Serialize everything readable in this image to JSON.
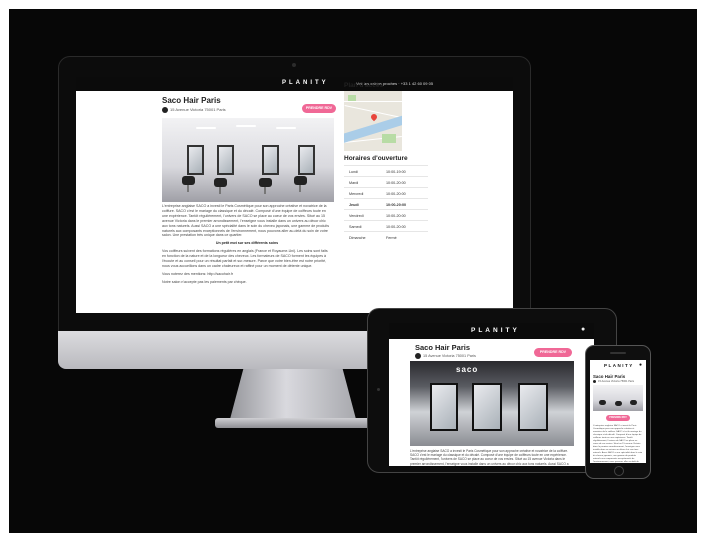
{
  "brand": "PLANITY",
  "top_links": "Voir les salons proches   ·   +33 1 42 60 09 05",
  "salon": {
    "name": "Saco Hair Paris",
    "address": "15 Avenue Victoria 75001 Paris",
    "cta_label": "PRENDRE RDV"
  },
  "map_section": {
    "title": "Plan d'accès"
  },
  "hours_section": {
    "title": "Horaires d'ouverture",
    "rows": [
      {
        "day": "Lundi",
        "hours": "10:00-19:00"
      },
      {
        "day": "Mardi",
        "hours": "10:00-20:00"
      },
      {
        "day": "Mercredi",
        "hours": "10:00-20:00"
      },
      {
        "day": "Jeudi",
        "hours": "10:00-20:00"
      },
      {
        "day": "Vendredi",
        "hours": "10:00-20:00"
      },
      {
        "day": "Samedi",
        "hours": "10:00-20:00"
      },
      {
        "day": "Dimanche",
        "hours": "Fermé"
      }
    ]
  },
  "description": {
    "p1": "L'entreprise anglaise SACO a investi le Paris Cosmétique pour son approche créative et novatrice de la coiffure. SACO c'est le mariage du classique et du décalé. Composé d'une équipe de coiffeurs toute en une expérience. Tantôt régulièrement, l'univers de SACO se place au coeur de vos envies. Situé au 15 avenue Victoria dans le premier arrondissement, l'enseigne vous installe dans un univers au décor chic aux tons naturels. Aussi SACO a une spécialité dans le soin du cheveu japonais, une gamme de produits naturels aux composants exceptionnels de l'environnement, nous pouvons aller au-delà du soin de votre salon. Une prestation très unique dans ce quartier.",
    "heading": "Un petit mot sur ses différents soins",
    "p2": "Vos coiffeurs suivent des formations régulières en anglais (France et Royaume-Uni). Les soins sont faits en fonction de la nature et de la longueur des cheveux. Les formateurs de SACO forment les équipes à l'écoute et au conseil pour un résultat parfait et sur-mesure. Parce que votre bien-être est notre priorité, nous vous accueillons dans un cadre chaleureux et raffiné pour un moment de détente unique.",
    "p3": "Vous noterez des mentions: http://sacohair.fr",
    "p4": "Notre salon n'accepte pas les paiements par chèque."
  }
}
